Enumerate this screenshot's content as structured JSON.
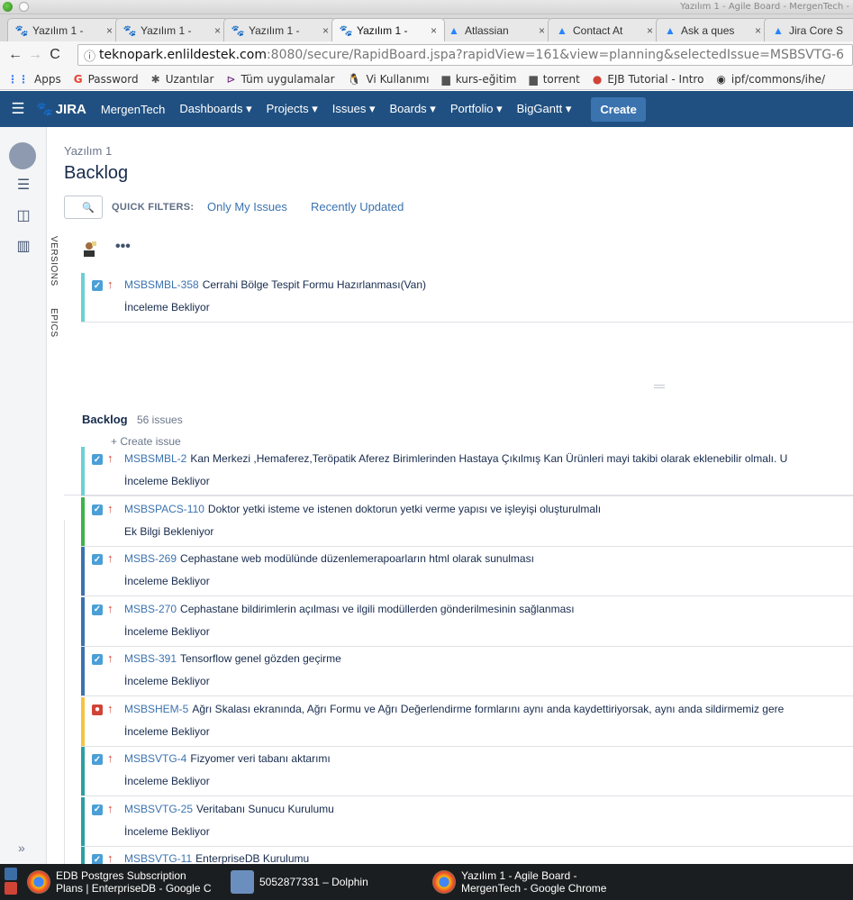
{
  "browser": {
    "window_title": "Yazılım 1 - Agile Board - MergenTech -",
    "tabs": [
      {
        "label": "Yazılım 1 -",
        "icon": "jira-icon",
        "active": false
      },
      {
        "label": "Yazılım 1 -",
        "icon": "jira-icon",
        "active": false
      },
      {
        "label": "Yazılım 1 -",
        "icon": "jira-icon",
        "active": false
      },
      {
        "label": "Yazılım 1 -",
        "icon": "jira-icon",
        "active": true
      },
      {
        "label": "Atlassian",
        "icon": "atlassian-icon",
        "active": false
      },
      {
        "label": "Contact At",
        "icon": "atlassian-icon",
        "active": false
      },
      {
        "label": "Ask a ques",
        "icon": "atlassian-icon",
        "active": false
      },
      {
        "label": "Jira Core S",
        "icon": "atlassian-icon",
        "active": false
      }
    ],
    "tab_close": "×",
    "url_host": "teknopark.enlildestek.com",
    "url_path": ":8080/secure/RapidBoard.jspa?rapidView=161&view=planning&selectedIssue=MSBSVTG-6",
    "bookmarks": [
      {
        "label": "Apps",
        "icon": "apps-icon"
      },
      {
        "label": "Password",
        "icon": "google-icon"
      },
      {
        "label": "Uzantılar",
        "icon": "puzzle-icon"
      },
      {
        "label": "Tüm uygulamalar",
        "icon": "visual-studio-icon"
      },
      {
        "label": "Vi Kullanımı",
        "icon": "linux-icon"
      },
      {
        "label": "kurs-eğitim",
        "icon": "folder-icon"
      },
      {
        "label": "torrent",
        "icon": "folder-icon"
      },
      {
        "label": "EJB Tutorial - Intro",
        "icon": "ejb-icon"
      },
      {
        "label": "ipf/commons/ihe/",
        "icon": "github-icon"
      }
    ]
  },
  "jira_header": {
    "logo": "JIRA",
    "org": "MergenTech",
    "menu": [
      "Dashboards ▾",
      "Projects ▾",
      "Issues ▾",
      "Boards ▾",
      "Portfolio ▾",
      "BigGantt ▾"
    ],
    "create": "Create"
  },
  "page": {
    "project": "Yazılım 1",
    "title": "Backlog",
    "quick_filters_label": "QUICK FILTERS:",
    "quick_filters": [
      "Only My Issues",
      "Recently Updated"
    ],
    "vertical_tabs": [
      "VERSIONS",
      "EPICS"
    ],
    "ellipsis": "•••",
    "create_issue": "+ Create issue"
  },
  "sprint_issues": [
    {
      "key": "MSBSMBL-358",
      "summary": "Cerrahi Bölge Tespit Formu Hazırlanması(Van)",
      "status": "İnceleme Bekliyor",
      "type": "task",
      "color": "#6bd0d3"
    }
  ],
  "backlog": {
    "heading": "Backlog",
    "count": "56 issues",
    "issues": [
      {
        "key": "MSBSMBL-2",
        "summary": "Kan Merkezi ,Hemaferez,Teröpatik Aferez Birimlerinden Hastaya Çıkılmış Kan Ürünleri mayi takibi olarak eklenebilir olmalı. U",
        "status": "İnceleme Bekliyor",
        "type": "task",
        "color": "#6bd0d3"
      },
      {
        "key": "MSBSPACS-110",
        "summary": "Doktor yetki isteme ve istenen doktorun yetki verme yapısı ve işleyişi oluşturulmalı",
        "status": "Ek Bilgi Bekleniyor",
        "type": "task",
        "color": "#3eb24a"
      },
      {
        "key": "MSBS-269",
        "summary": "Cephastane web modülünde düzenlemerapoarların html olarak sunulması",
        "status": "İnceleme Bekliyor",
        "type": "task",
        "color": "#3b73af"
      },
      {
        "key": "MSBS-270",
        "summary": "Cephastane bildirimlerin açılması ve ilgili modüllerden gönderilmesinin sağlanması",
        "status": "İnceleme Bekliyor",
        "type": "task",
        "color": "#3b73af"
      },
      {
        "key": "MSBS-391",
        "summary": "Tensorflow genel gözden geçirme",
        "status": "İnceleme Bekliyor",
        "type": "task",
        "color": "#3b73af"
      },
      {
        "key": "MSBSHEM-5",
        "summary": "Ağrı Skalası ekranında, Ağrı Formu ve Ağrı Değerlendirme formlarını aynı anda kaydettiriyorsak, aynı anda sildirmemiz gere",
        "status": "İnceleme Bekliyor",
        "type": "bug",
        "color": "#f6c342"
      },
      {
        "key": "MSBSVTG-4",
        "summary": "Fizyomer veri tabanı aktarımı",
        "status": "İnceleme Bekliyor",
        "type": "task",
        "color": "#2a9fa3"
      },
      {
        "key": "MSBSVTG-25",
        "summary": "Veritabanı Sunucu Kurulumu",
        "status": "İnceleme Bekliyor",
        "type": "task",
        "color": "#2a9fa3"
      },
      {
        "key": "MSBSVTG-11",
        "summary": "EnterpriseDB Kurulumu",
        "status": "",
        "type": "task",
        "color": "#2a9fa3"
      }
    ]
  },
  "taskbar": [
    {
      "line1": "EDB Postgres Subscription",
      "line2": "Plans | EnterpriseDB - Google C",
      "icon": "chrome-icon"
    },
    {
      "line1": "5052877331 – Dolphin",
      "line2": "",
      "icon": "dolphin-icon"
    },
    {
      "line1": "Yazılım 1 - Agile Board -",
      "line2": "MergenTech - Google Chrome",
      "icon": "chrome-icon"
    }
  ]
}
